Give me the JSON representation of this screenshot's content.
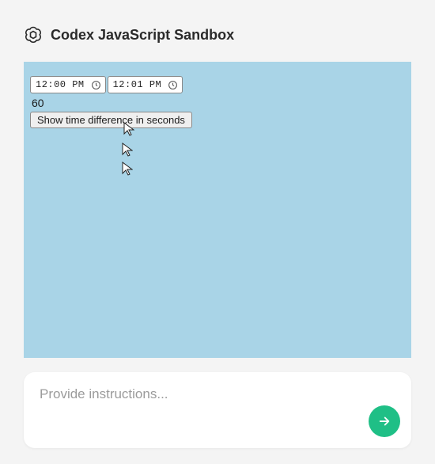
{
  "header": {
    "title": "Codex JavaScript Sandbox"
  },
  "sandbox": {
    "time1": "12:00 PM",
    "time2": "12:01 PM",
    "result": "60",
    "button_label": "Show time difference in seconds"
  },
  "prompt": {
    "placeholder": "Provide instructions..."
  },
  "icons": {
    "logo": "openai-logo-icon",
    "clock": "clock-icon",
    "cursor": "cursor-icon",
    "send": "arrow-right-icon"
  }
}
